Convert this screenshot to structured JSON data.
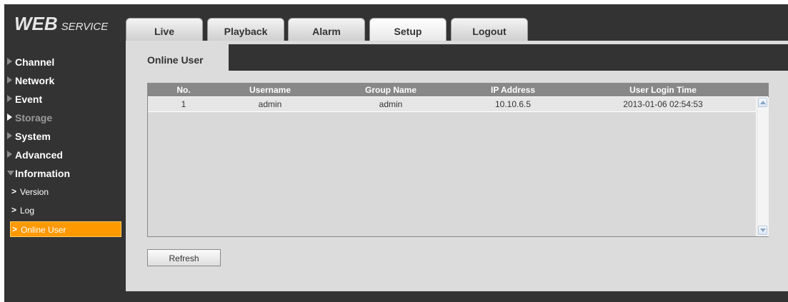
{
  "logo": {
    "main": "WEB",
    "sub": "SERVICE"
  },
  "tabs": [
    {
      "label": "Live"
    },
    {
      "label": "Playback"
    },
    {
      "label": "Alarm"
    },
    {
      "label": "Setup",
      "active": true
    },
    {
      "label": "Logout"
    }
  ],
  "sidebar": {
    "items": [
      {
        "label": "Channel"
      },
      {
        "label": "Network"
      },
      {
        "label": "Event"
      },
      {
        "label": "Storage"
      },
      {
        "label": "System"
      },
      {
        "label": "Advanced"
      },
      {
        "label": "Information"
      }
    ],
    "subitems": [
      {
        "label": "Version"
      },
      {
        "label": "Log"
      },
      {
        "label": "Online User",
        "active": true
      }
    ]
  },
  "content": {
    "tab_label": "Online User",
    "table": {
      "headers": [
        "No.",
        "Username",
        "Group Name",
        "IP Address",
        "User Login Time"
      ],
      "rows": [
        [
          "1",
          "admin",
          "admin",
          "10.10.6.5",
          "2013-01-06 02:54:53"
        ]
      ]
    },
    "refresh_label": "Refresh"
  },
  "colors": {
    "background": "#333333",
    "panel": "#dcdcdc",
    "accent": "#ff9900",
    "table_header": "#888888"
  },
  "icons": {
    "sidebar_collapsed": "triangle-right-icon",
    "sidebar_expanded": "triangle-down-icon",
    "submenu": "chevron-right-icon",
    "scroll_up": "scroll-up-icon",
    "scroll_down": "scroll-down-icon"
  }
}
